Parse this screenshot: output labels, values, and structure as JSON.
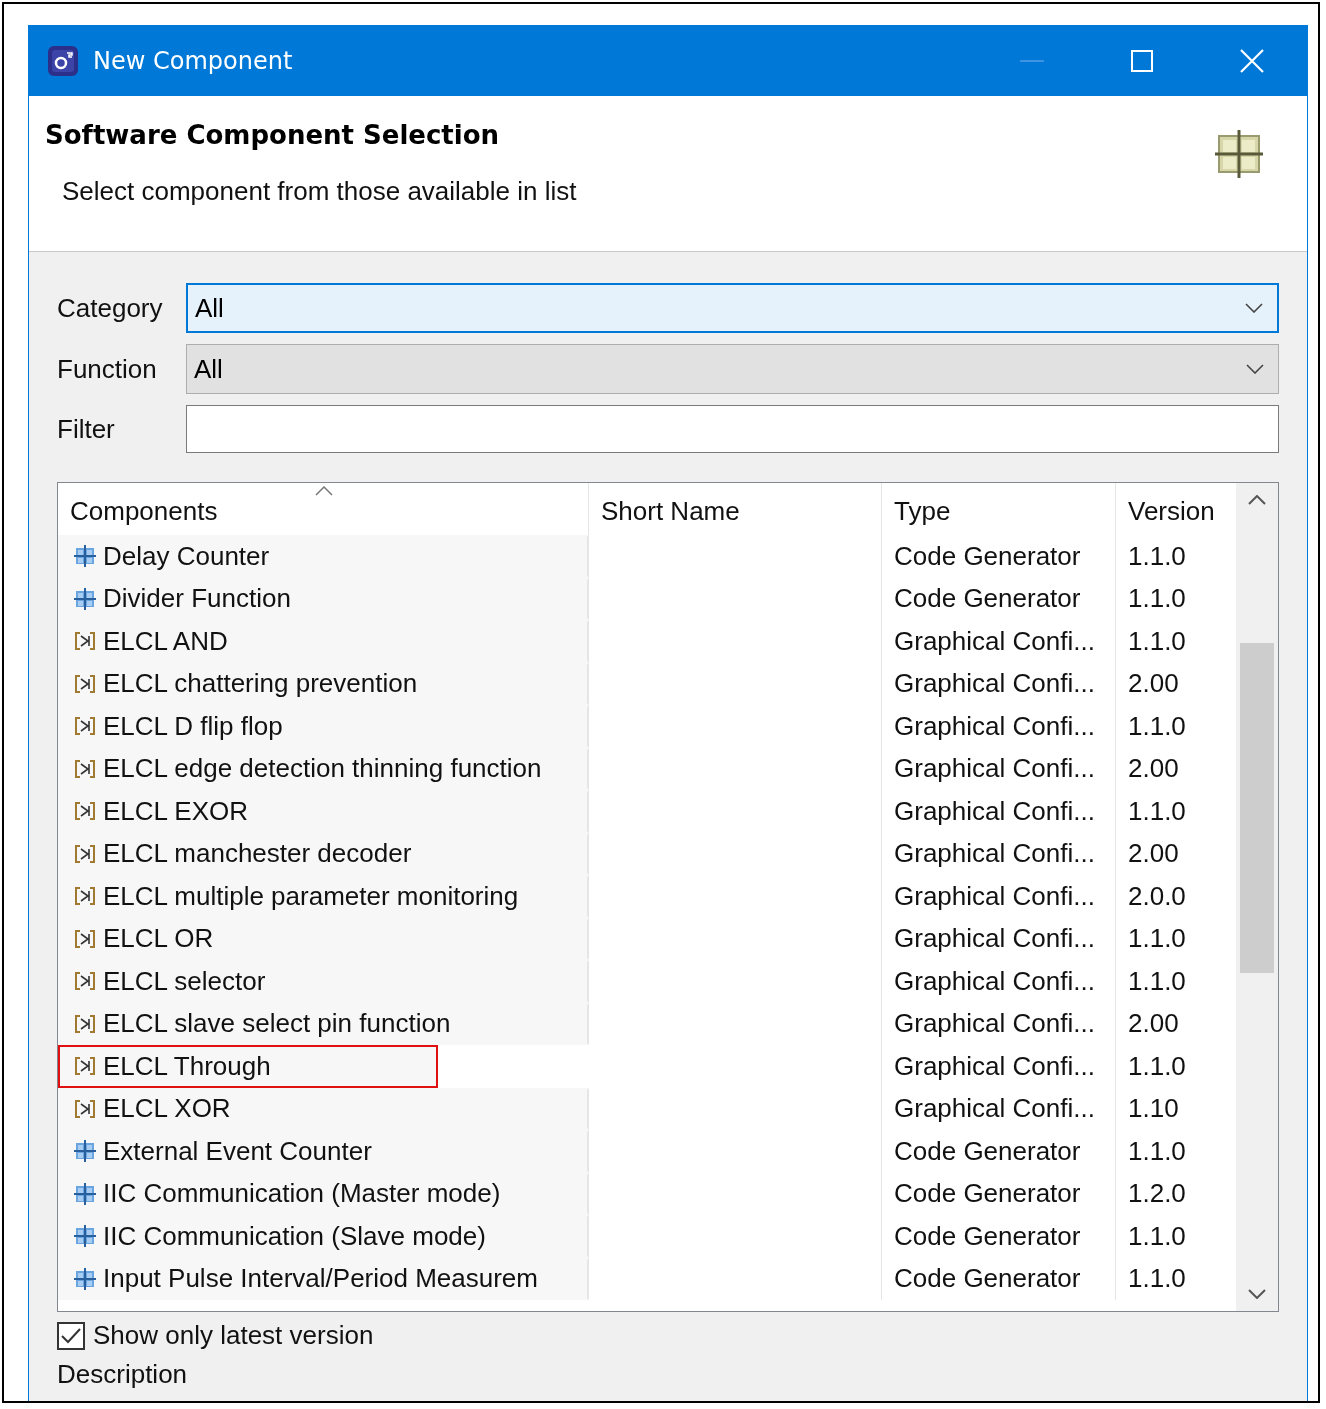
{
  "window": {
    "title": "New Component"
  },
  "header": {
    "title": "Software Component Selection",
    "subtitle": "Select component from those available in list"
  },
  "fields": [
    {
      "label": "Category",
      "value": "All",
      "kind": "combo",
      "focused": true
    },
    {
      "label": "Function",
      "value": "All",
      "kind": "combo",
      "focused": false
    },
    {
      "label": "Filter",
      "kind": "text",
      "focused": false
    }
  ],
  "table": {
    "columns": [
      "Components",
      "Short Name",
      "Type",
      "Version"
    ],
    "rows": [
      {
        "name": "Delay Counter",
        "kind": "code",
        "short_name": "",
        "type": "Code Generator",
        "version": "1.1.0",
        "highlighted": false
      },
      {
        "name": "Divider Function",
        "kind": "code",
        "short_name": "",
        "type": "Code Generator",
        "version": "1.1.0",
        "highlighted": false
      },
      {
        "name": "ELCL AND",
        "kind": "graphical",
        "short_name": "",
        "type": "Graphical Confi...",
        "version": "1.1.0",
        "highlighted": false
      },
      {
        "name": "ELCL chattering prevention",
        "kind": "graphical",
        "short_name": "",
        "type": "Graphical Confi...",
        "version": "2.00",
        "highlighted": false
      },
      {
        "name": "ELCL D flip flop",
        "kind": "graphical",
        "short_name": "",
        "type": "Graphical Confi...",
        "version": "1.1.0",
        "highlighted": false
      },
      {
        "name": "ELCL edge detection thinning function",
        "kind": "graphical",
        "short_name": "",
        "type": "Graphical Confi...",
        "version": "2.00",
        "highlighted": false
      },
      {
        "name": "ELCL EXOR",
        "kind": "graphical",
        "short_name": "",
        "type": "Graphical Confi...",
        "version": "1.1.0",
        "highlighted": false
      },
      {
        "name": "ELCL manchester decoder",
        "kind": "graphical",
        "short_name": "",
        "type": "Graphical Confi...",
        "version": "2.00",
        "highlighted": false
      },
      {
        "name": "ELCL multiple parameter monitoring",
        "kind": "graphical",
        "short_name": "",
        "type": "Graphical Confi...",
        "version": "2.0.0",
        "highlighted": false
      },
      {
        "name": "ELCL OR",
        "kind": "graphical",
        "short_name": "",
        "type": "Graphical Confi...",
        "version": "1.1.0",
        "highlighted": false
      },
      {
        "name": "ELCL selector",
        "kind": "graphical",
        "short_name": "",
        "type": "Graphical Confi...",
        "version": "1.1.0",
        "highlighted": false
      },
      {
        "name": "ELCL slave select pin function",
        "kind": "graphical",
        "short_name": "",
        "type": "Graphical Confi...",
        "version": "2.00",
        "highlighted": false
      },
      {
        "name": "ELCL Through",
        "kind": "graphical",
        "short_name": "",
        "type": "Graphical Confi...",
        "version": "1.1.0",
        "highlighted": true
      },
      {
        "name": "ELCL XOR",
        "kind": "graphical",
        "short_name": "",
        "type": "Graphical Confi...",
        "version": "1.10",
        "highlighted": false
      },
      {
        "name": "External Event Counter",
        "kind": "code",
        "short_name": "",
        "type": "Code Generator",
        "version": "1.1.0",
        "highlighted": false
      },
      {
        "name": "IIC Communication (Master mode)",
        "kind": "code",
        "short_name": "",
        "type": "Code Generator",
        "version": "1.2.0",
        "highlighted": false
      },
      {
        "name": "IIC Communication (Slave mode)",
        "kind": "code",
        "short_name": "",
        "type": "Code Generator",
        "version": "1.1.0",
        "highlighted": false
      },
      {
        "name": "Input Pulse Interval/Period Measurem",
        "kind": "code",
        "short_name": "",
        "type": "Code Generator",
        "version": "1.1.0",
        "highlighted": false
      }
    ]
  },
  "show_latest": {
    "label": "Show only latest version",
    "checked": true
  },
  "description": {
    "label": "Description"
  }
}
